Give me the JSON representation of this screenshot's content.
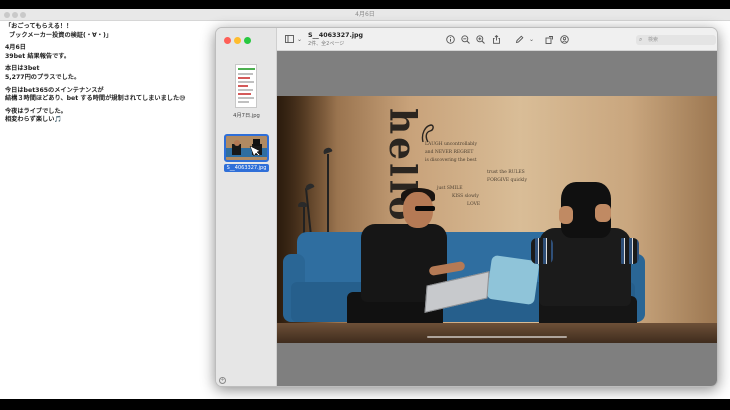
{
  "editor": {
    "title": "4月6日",
    "lines": [
      "「おごってもらえる！！",
      "ブックメーカー投資の検証(・∀・)」",
      "",
      "4月6日",
      "39bet 結果報告です。",
      "",
      "本日は3bet",
      "5,277円のプラスでした。",
      "",
      "今日はbet365のメインテナンスが",
      "結構３時間ほどあり、bet する時間が規制されてしまいました😅",
      "",
      "今夜はライブでした。",
      "相変わらず楽しい🎵"
    ]
  },
  "preview": {
    "filename": "S__4063327.jpg",
    "subtitle": "2件、全2ページ",
    "search_placeholder": "検索",
    "thumbnails": [
      {
        "label": "4月7日.jpg",
        "selected": false
      },
      {
        "label": "S__4063327.jpg",
        "selected": true
      }
    ],
    "toolbar_icons": [
      "sidebar-toggle-icon",
      "chevron-down-icon",
      "info-icon",
      "zoom-out-icon",
      "zoom-in-icon",
      "share-icon",
      "markup-pen-icon",
      "chevron-down-icon",
      "rotate-icon",
      "annotate-icon",
      "search-icon"
    ]
  },
  "photo": {
    "wall_big_text": "hello.",
    "wall_text_lines": [
      "LAUGH uncontrollably",
      "and NEVER REGRET",
      "is discovering the best",
      "trust the RULES",
      "FORGIVE quickly",
      "just SMILE",
      "KISS slowly",
      "LOVE"
    ]
  },
  "colors": {
    "selection": "#2f6fd8",
    "traffic_red": "#fe5f57",
    "traffic_yellow": "#febc2e",
    "traffic_green": "#28c840"
  }
}
